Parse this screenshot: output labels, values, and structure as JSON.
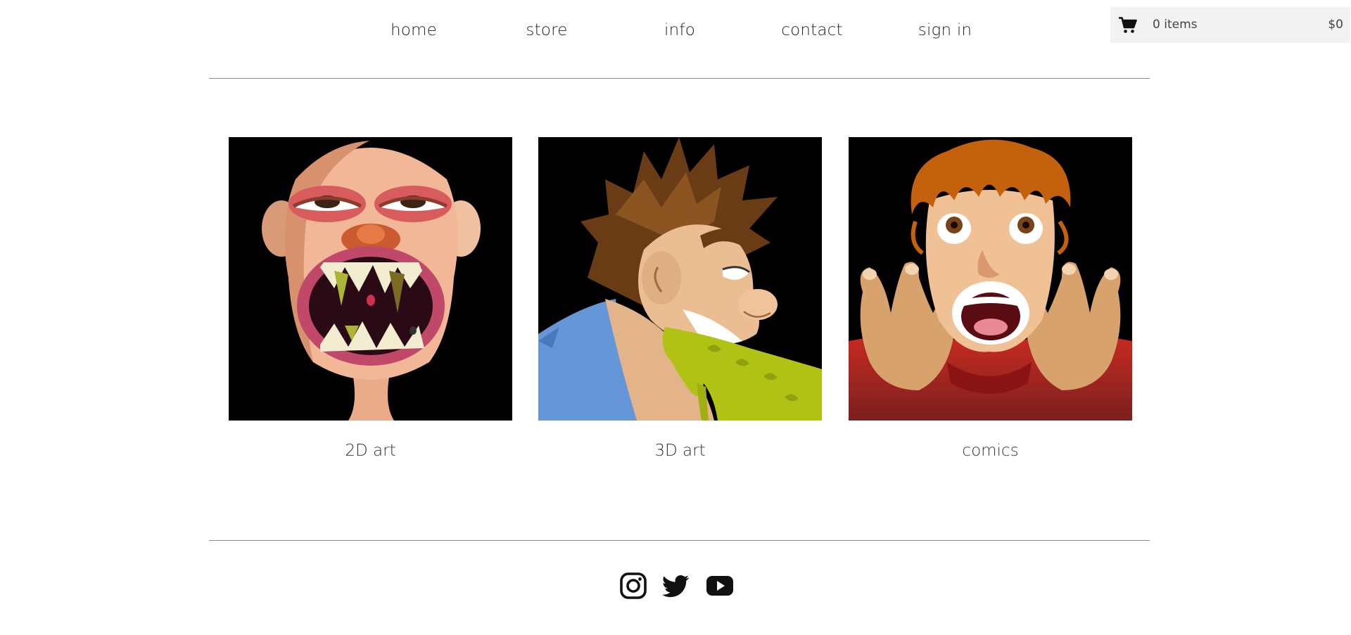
{
  "nav": {
    "items": [
      {
        "label": "home"
      },
      {
        "label": "store"
      },
      {
        "label": "info"
      },
      {
        "label": "contact"
      },
      {
        "label": "sign in"
      }
    ]
  },
  "cart": {
    "icon": "shopping-cart-icon",
    "items_label": "0 items",
    "total": "$0"
  },
  "gallery": {
    "cards": [
      {
        "caption": "2D art"
      },
      {
        "caption": "3D art"
      },
      {
        "caption": "comics"
      }
    ]
  },
  "social": {
    "icons": [
      "instagram-icon",
      "twitter-icon",
      "youtube-icon"
    ]
  }
}
